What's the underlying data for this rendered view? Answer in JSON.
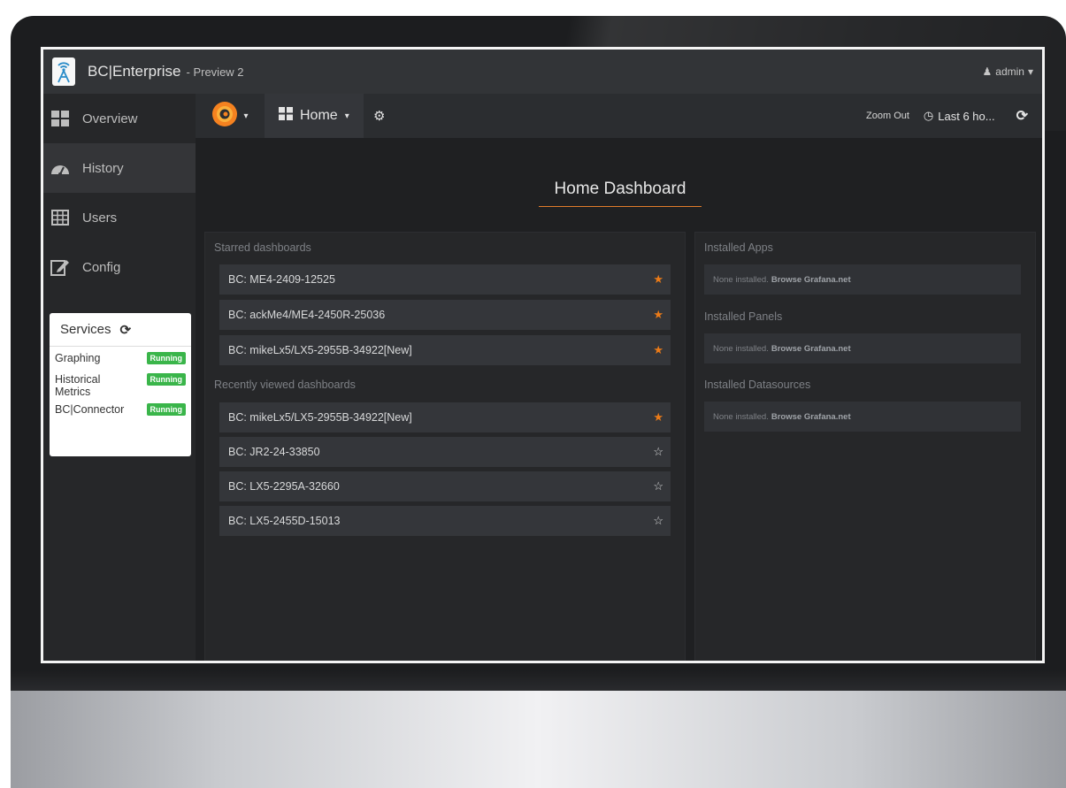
{
  "app": {
    "title": "BC|Enterprise",
    "subtitle": "- Preview 2",
    "user_label": "admin"
  },
  "sidebar": {
    "items": [
      {
        "label": "Overview",
        "icon": "grid-icon",
        "active": false
      },
      {
        "label": "History",
        "icon": "dashboard-gauge-icon",
        "active": true
      },
      {
        "label": "Users",
        "icon": "table-icon",
        "active": false
      },
      {
        "label": "Config",
        "icon": "edit-icon",
        "active": false
      }
    ]
  },
  "services": {
    "title": "Services",
    "items": [
      {
        "name": "Graphing",
        "status": "Running"
      },
      {
        "name": "Historical Metrics",
        "status": "Running"
      },
      {
        "name": "BC|Connector",
        "status": "Running"
      }
    ]
  },
  "dashbar": {
    "home_label": "Home",
    "zoom_out_label": "Zoom Out",
    "time_range_label": "Last 6 ho..."
  },
  "dashboard": {
    "title": "Home Dashboard",
    "starred_label": "Starred dashboards",
    "starred": [
      {
        "name": "BC: ME4-2409-12525",
        "starred": true
      },
      {
        "name": "BC: ackMe4/ME4-2450R-25036",
        "starred": true
      },
      {
        "name": "BC: mikeLx5/LX5-2955B-34922[New]",
        "starred": true
      }
    ],
    "recent_label": "Recently viewed dashboards",
    "recent": [
      {
        "name": "BC: mikeLx5/LX5-2955B-34922[New]",
        "starred": true
      },
      {
        "name": "BC: JR2-24-33850",
        "starred": false
      },
      {
        "name": "BC: LX5-2295A-32660",
        "starred": false
      },
      {
        "name": "BC: LX5-2455D-15013",
        "starred": false
      }
    ]
  },
  "plugins": {
    "apps_label": "Installed Apps",
    "panels_label": "Installed Panels",
    "datasources_label": "Installed Datasources",
    "none_text": "None installed.",
    "browse_text": "Browse Grafana.net"
  },
  "colors": {
    "star_active": "#eb7b18",
    "running_badge": "#3ab54a",
    "title_underline": "#e07b2b"
  }
}
